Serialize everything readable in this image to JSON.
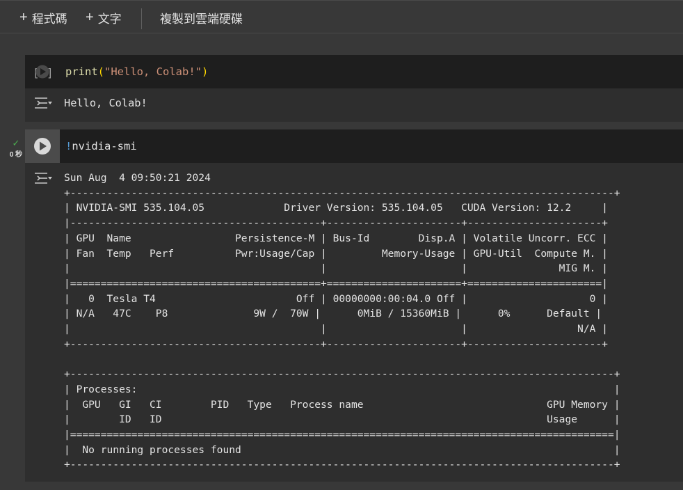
{
  "toolbar": {
    "add_code_label": "程式碼",
    "add_text_label": "文字",
    "copy_to_drive_label": "複製到雲端硬碟"
  },
  "cells": [
    {
      "code_func": "print",
      "code_open": "(",
      "code_string": "\"Hello, Colab!\"",
      "code_close": ")",
      "output": "Hello, Colab!"
    },
    {
      "code_bang": "!",
      "code_cmd": "nvidia-smi",
      "status_time": "0 秒",
      "output": "Sun Aug  4 09:50:21 2024\n+-----------------------------------------------------------------------------------------+\n| NVIDIA-SMI 535.104.05             Driver Version: 535.104.05   CUDA Version: 12.2     |\n|-----------------------------------------+----------------------+----------------------+\n| GPU  Name                 Persistence-M | Bus-Id        Disp.A | Volatile Uncorr. ECC |\n| Fan  Temp   Perf          Pwr:Usage/Cap |         Memory-Usage | GPU-Util  Compute M. |\n|                                         |                      |               MIG M. |\n|=========================================+======================+======================|\n|   0  Tesla T4                       Off | 00000000:00:04.0 Off |                    0 |\n| N/A   47C    P8              9W /  70W |      0MiB / 15360MiB |      0%      Default |\n|                                         |                      |                  N/A |\n+-----------------------------------------+----------------------+----------------------+\n\n+-----------------------------------------------------------------------------------------+\n| Processes:                                                                              |\n|  GPU   GI   CI        PID   Type   Process name                              GPU Memory |\n|        ID   ID                                                               Usage      |\n|=========================================================================================|\n|  No running processes found                                                             |\n+-----------------------------------------------------------------------------------------+"
    }
  ],
  "colors": {
    "code_func": "#dcdcaa",
    "code_string": "#ce9178",
    "code_bang": "#569cd6",
    "success": "#4caf50"
  }
}
